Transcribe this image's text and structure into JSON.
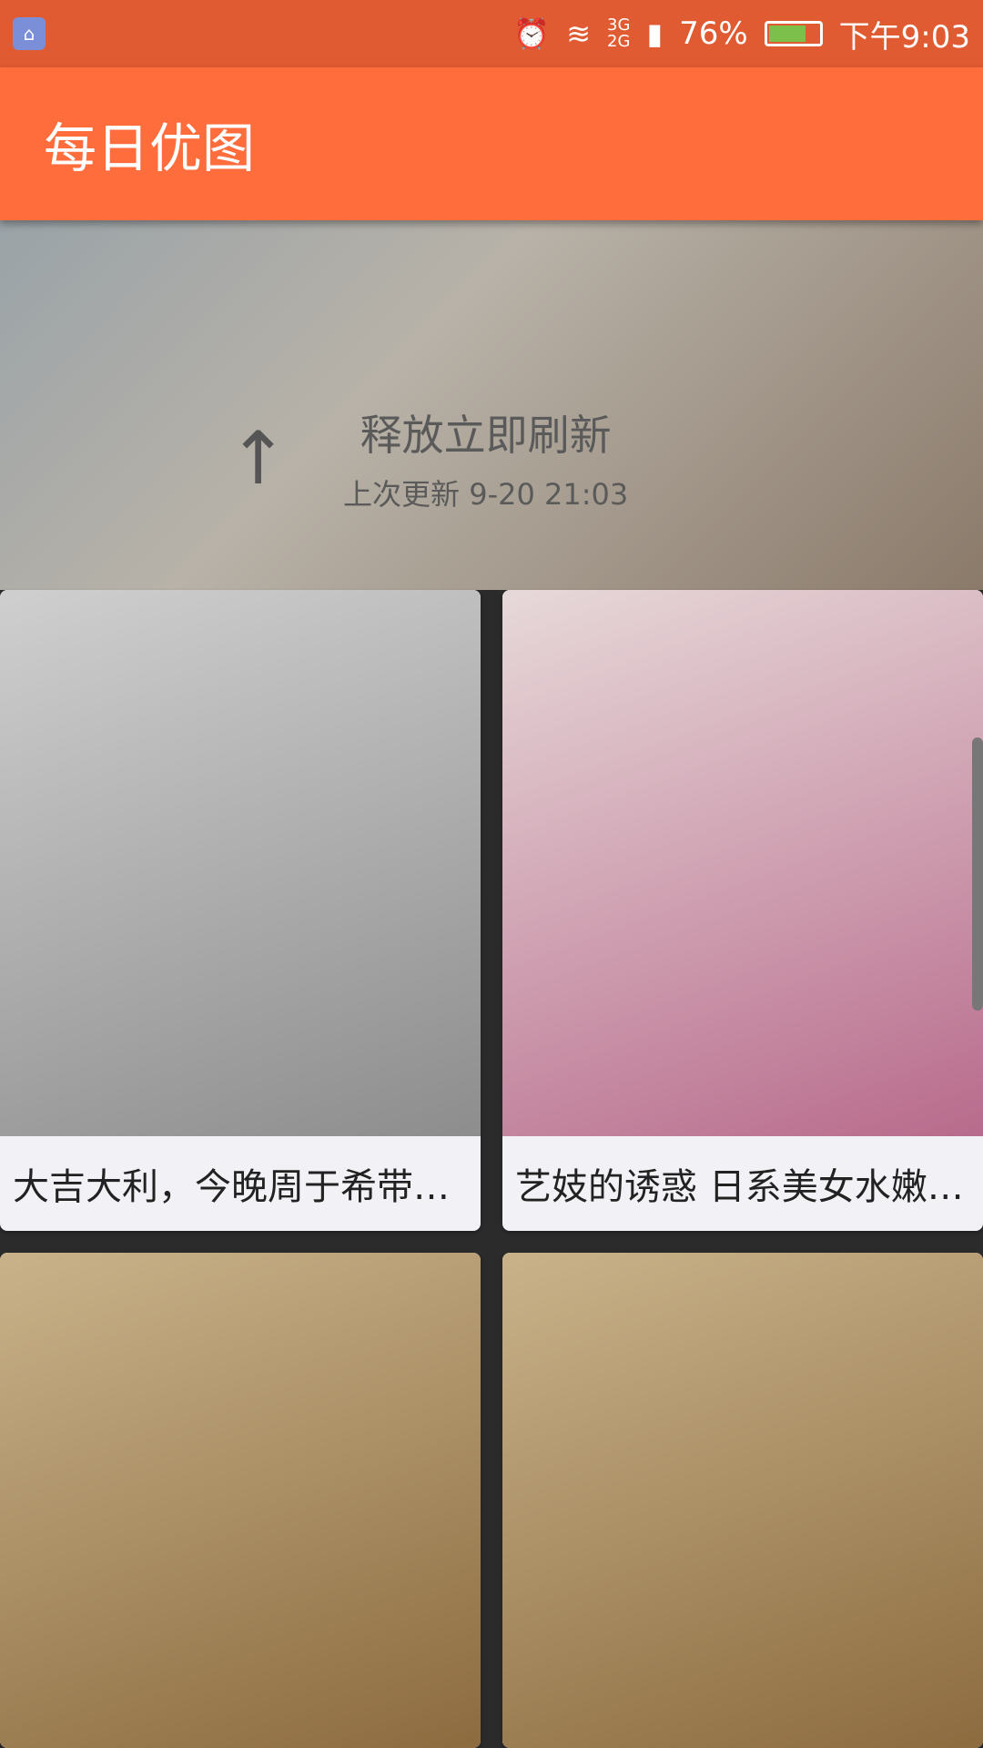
{
  "status_bar": {
    "usb_icon": "usb-icon",
    "alarm_icon": "alarm-icon",
    "wifi_icon": "wifi-icon",
    "network_label_1": "3G",
    "network_label_2": "2G",
    "battery_percent": "76%",
    "battery_level": 0.76,
    "time": "下午9:03"
  },
  "app_bar": {
    "title": "每日优图"
  },
  "refresh": {
    "arrow_icon": "arrow-up-icon",
    "main_text": "释放立即刷新",
    "last_updated": "上次更新 9-20 21:03"
  },
  "cards": [
    {
      "caption": "大吉大利，今晚周于希带…"
    },
    {
      "caption": "艺妓的诱惑 日系美女水嫩…"
    },
    {
      "caption": ""
    },
    {
      "caption": ""
    }
  ]
}
